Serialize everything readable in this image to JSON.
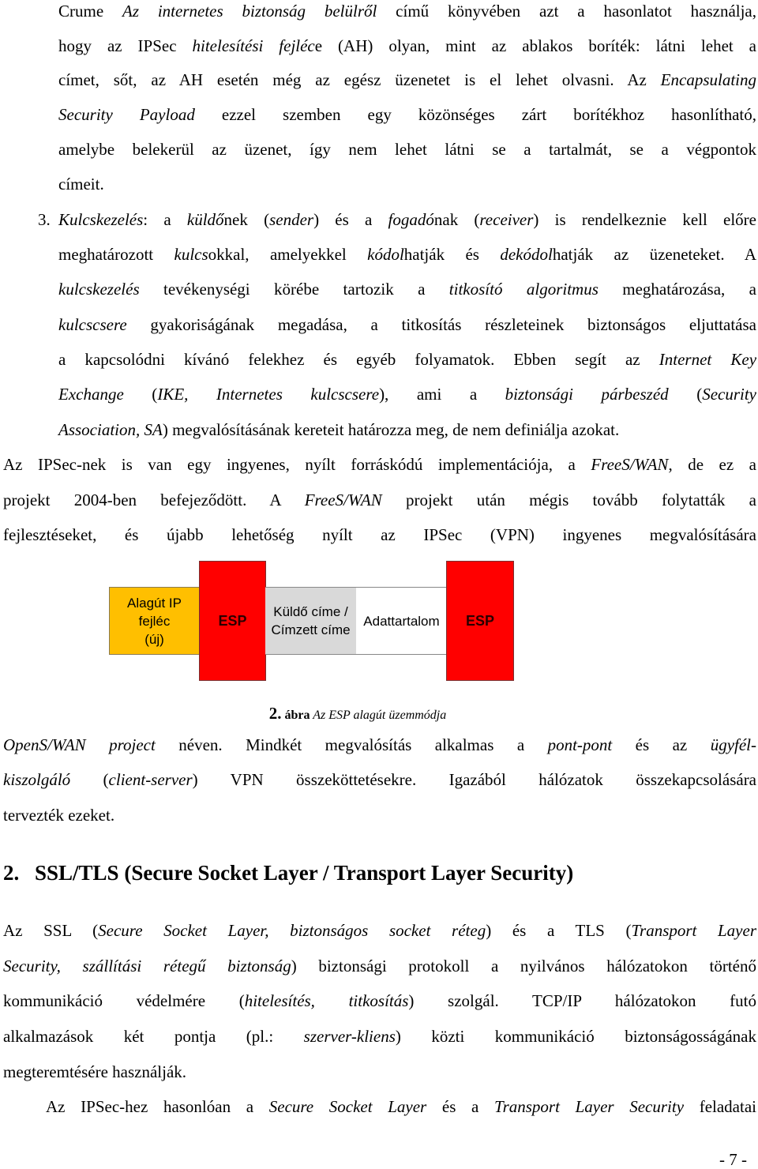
{
  "para_intro": {
    "l1a": "Crume ",
    "l1i": "Az internetes biztonság belülről",
    "l1b": " című könyvében azt a hasonlatot használja,",
    "l2a": "hogy az IPSec ",
    "l2i": "hitelesítési fejléc",
    "l2b": "e (AH) olyan, mint az ablakos boríték: látni lehet a",
    "l3a": "címet, sőt, az AH esetén még az egész üzenetet is el lehet olvasni. Az ",
    "l3i": "Encapsulating",
    "l4i": "Security Payload",
    "l4b": " ezzel szemben egy közönséges zárt borítékhoz hasonlítható,",
    "l5": "amelybe belekerül az üzenet, így nem lehet látni se a tartalmát, se a végpontok",
    "l6": "címeit."
  },
  "list_item_3": {
    "number": "3.",
    "l1i1": "Kulcskezelés",
    "l1a": ": a ",
    "l1i2": "küldő",
    "l1b": "nek (",
    "l1i3": "sender",
    "l1c": ") és a ",
    "l1i4": "fogadó",
    "l1d": "nak (",
    "l1i5": "receiver",
    "l1e": ") is rendelkeznie kell előre",
    "l2a": "meghatározott ",
    "l2i1": "kulcs",
    "l2b": "okkal, amelyekkel ",
    "l2i2": "kódol",
    "l2c": "hatják és ",
    "l2i3": "dekódol",
    "l2d": "hatják az üzeneteket. A",
    "l3i1": "kulcskezelés",
    "l3a": " tevékenységi körébe tartozik a ",
    "l3i2": "titkosító algoritmus",
    "l3b": " meghatározása, a",
    "l4i": "kulcscsere",
    "l4b": " gyakoriságának megadása, a titkosítás részleteinek biztonságos eljuttatása",
    "l5a": "a kapcsolódni kívánó felekhez és egyéb folyamatok. Ebben segít az ",
    "l5i": "Internet Key",
    "l6i1": "Exchange",
    "l6a": " (",
    "l6i2": "IKE, Internetes kulcscsere",
    "l6b": "), ami a ",
    "l6i3": "biztonsági párbeszéd",
    "l6c": " (",
    "l6i4": "Security",
    "l7i": "Association, SA",
    "l7b": ") megvalósításának kereteit határozza meg, de nem definiálja azokat."
  },
  "para_freeswan": {
    "l1a": "Az IPSec-nek is van egy ingyenes, nyílt forráskódú implementációja, a ",
    "l1i": "FreeS/WAN",
    "l1b": ", de ez a",
    "l2a": "projekt 2004-ben befejeződött. A ",
    "l2i": "FreeS/WAN",
    "l2b": " projekt után mégis tovább folytatták a",
    "l3": "fejlesztéseket, és újabb lehetőség nyílt az IPSec (VPN) ingyenes megvalósítására"
  },
  "diagram": {
    "boxes": [
      {
        "label": "Alagút IP fejléc (új)",
        "line1": "Alagút IP fejléc",
        "line2": "(új)",
        "color": "#ffbf00"
      },
      {
        "label": "ESP",
        "color": "#ff0000"
      },
      {
        "label": "Küldő címe / Címzett címe",
        "line1": "Küldő címe /",
        "line2": "Címzett címe",
        "color": "#d9d9d9"
      },
      {
        "label": "Adattartalom",
        "color": "#ffffff"
      },
      {
        "label": "ESP",
        "color": "#ff0000"
      }
    ],
    "caption": {
      "number": "2.",
      "word": " ábra",
      "title": " Az ESP alagút üzemmódja"
    }
  },
  "para_openswan": {
    "l1i1": "OpenS/WAN project",
    "l1a": " néven. Mindkét megvalósítás alkalmas a ",
    "l1i2": "pont-pont",
    "l1b": " és az ",
    "l1i3": "ügyfél-",
    "l2i1": "kiszolgáló",
    "l2a": " (",
    "l2i2": "client-server",
    "l2b": ") VPN összeköttetésekre. Igazából hálózatok összekapcsolására",
    "l3": "tervezték ezeket."
  },
  "section_heading": {
    "number": "2.",
    "title": "SSL/TLS (Secure Socket Layer / Transport Layer Security)"
  },
  "para_ssl": {
    "l1a": "Az SSL (",
    "l1i1": "Secure Socket Layer, biztonságos socket réteg",
    "l1b": ") és a TLS (",
    "l1i2": "Transport Layer",
    "l2i": "Security, szállítási rétegű biztonság",
    "l2b": ") biztonsági protokoll a nyilvános hálózatokon történő",
    "l3a": "kommunikáció védelmére (",
    "l3i": "hitelesítés, titkosítás",
    "l3b": ") szolgál. TCP/IP hálózatokon futó",
    "l4a": "alkalmazások két pontja (pl.: ",
    "l4i": "szerver-kliens",
    "l4b": ") közti kommunikáció biztonságosságának",
    "l5": "megteremtésére használják."
  },
  "para_last": {
    "a": "Az IPSec-hez hasonlóan a ",
    "i1": "Secure Socket Layer",
    "b": " és a ",
    "i2": "Transport Layer Security",
    "c": " feladatai"
  },
  "page_number": "- 7 -"
}
